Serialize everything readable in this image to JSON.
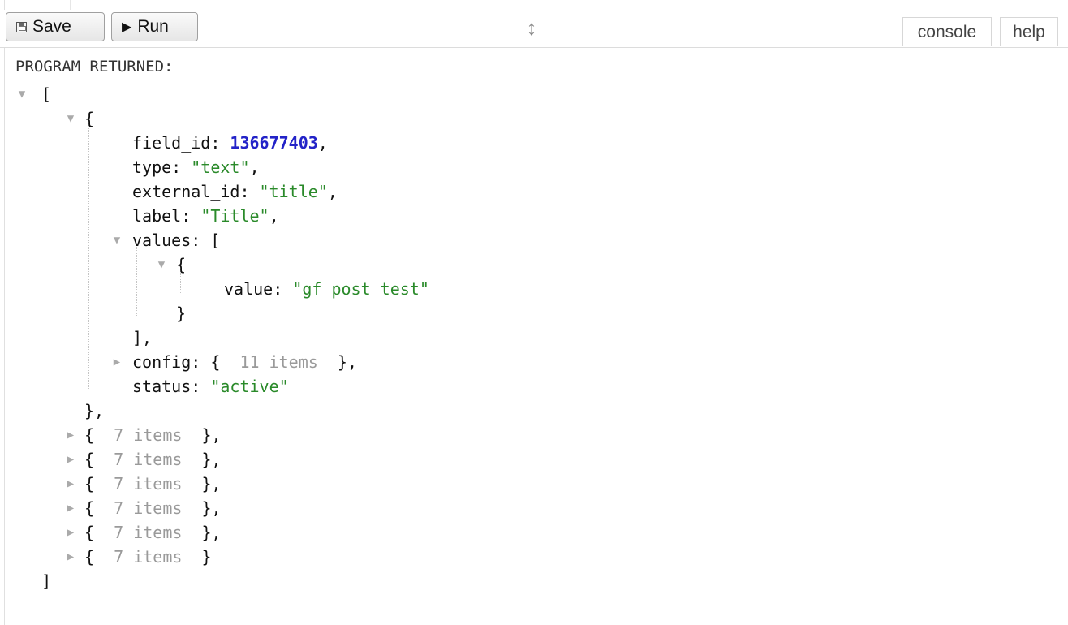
{
  "toolbar": {
    "save_label": "Save",
    "run_label": "Run",
    "tabs": {
      "console": "console",
      "help": "help"
    }
  },
  "output": {
    "heading": "PROGRAM RETURNED:",
    "first_object": {
      "field_id_key": "field_id",
      "field_id_value": "136677403",
      "type_key": "type",
      "type_value": "\"text\"",
      "external_id_key": "external_id",
      "external_id_value": "\"title\"",
      "label_key": "label",
      "label_value": "\"Title\"",
      "values_key": "values",
      "value_key": "value",
      "value_value": "\"gf post test\"",
      "config_key": "config",
      "config_summary": "11 items",
      "status_key": "status",
      "status_value": "\"active\""
    },
    "collapsed_items": [
      {
        "summary": "7 items",
        "suffix": " },",
        "expanded": false
      },
      {
        "summary": "7 items",
        "suffix": " },",
        "expanded": false
      },
      {
        "summary": "7 items",
        "suffix": " },",
        "expanded": false
      },
      {
        "summary": "7 items",
        "suffix": " },",
        "expanded": false
      },
      {
        "summary": "7 items",
        "suffix": " },",
        "expanded": false
      },
      {
        "summary": "7 items",
        "suffix": " }",
        "expanded": false
      }
    ]
  },
  "colors": {
    "number": "#2323c8",
    "string": "#2a8a2a",
    "summary": "#9a9a9a",
    "toggle": "#aaaaaa"
  },
  "icons": {
    "save": "floppy-disk-icon",
    "run": "play-icon",
    "resize": "vertical-resize-icon",
    "expanded": "triangle-down-icon",
    "collapsed": "triangle-right-icon"
  }
}
